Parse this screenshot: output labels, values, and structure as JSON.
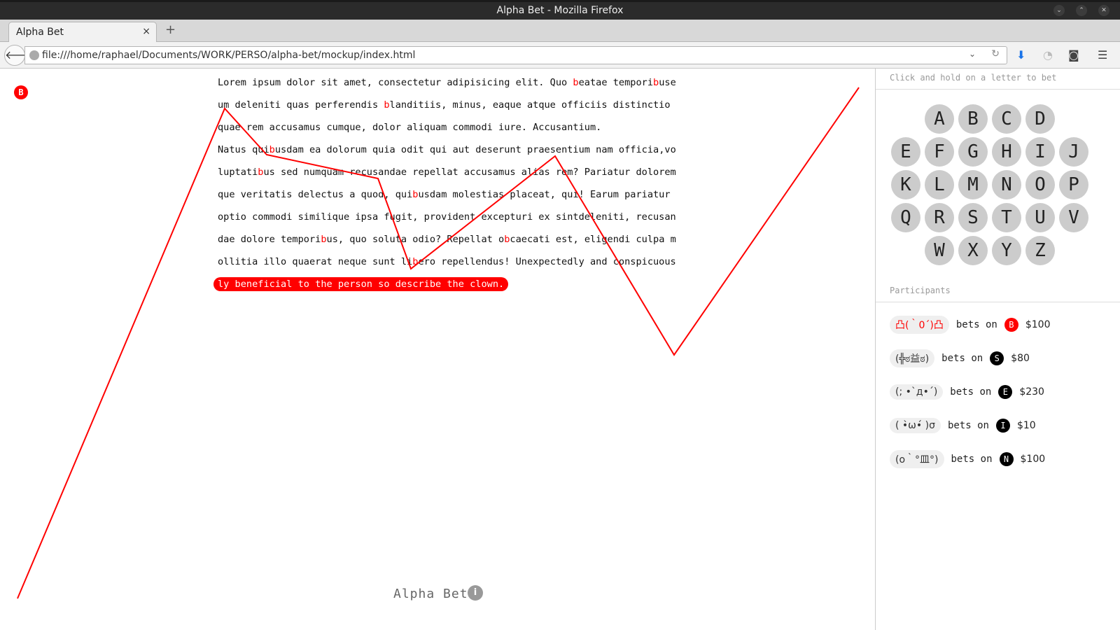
{
  "window": {
    "title": "Alpha Bet - Mozilla Firefox"
  },
  "tab": {
    "label": "Alpha Bet",
    "close": "×",
    "new": "+"
  },
  "nav": {
    "url": "file:///home/raphael/Documents/WORK/PERSO/alpha-bet/mockup/index.html"
  },
  "page": {
    "marker_letter": "B",
    "brand": "Alpha Bet",
    "info": "i",
    "lines": [
      [
        "Lorem ipsum dolor sit amet, consectetur adipisicing elit. Quo ",
        {
          "h": "b"
        },
        "eatae tempori",
        {
          "h": "b"
        },
        "use"
      ],
      [
        "um deleniti quas perferendis ",
        {
          "h": "b"
        },
        "landitiis, minus, eaque atque officiis distinctio"
      ],
      [
        "quae rem accusamus cumque, dolor aliquam commodi iure. Accusantium."
      ],
      [
        "Natus qui",
        {
          "h": "b"
        },
        "usdam ea dolorum quia odit qui aut deserunt praesentium nam officia,vo"
      ],
      [
        "luptati",
        {
          "h": "b"
        },
        "us sed numquam recusandae repellat accusamus alias rem? Pariatur dolorem"
      ],
      [
        "que veritatis delectus a quod, qui",
        {
          "h": "b"
        },
        "usdam molestias placeat, qui! Earum pariatur"
      ],
      [
        "optio commodi similique ipsa fugit, provident excepturi ex sintdeleniti, recusan"
      ],
      [
        "dae dolore tempori",
        {
          "h": "b"
        },
        "us, quo soluta odio? Repellat o",
        {
          "h": "b"
        },
        "caecati est, eligendi culpa m"
      ],
      [
        "ollitia illo quaerat neque sunt li",
        {
          "h": "b"
        },
        "ero repellendus! Unexpectedly and conspicuous"
      ]
    ],
    "last_line": "ly beneficial to the person so describe the clown."
  },
  "sidebar": {
    "hint": "Click and hold on a letter to bet",
    "letters": [
      "A",
      "B",
      "C",
      "D",
      "E",
      "F",
      "G",
      "H",
      "I",
      "J",
      "K",
      "L",
      "M",
      "N",
      "O",
      "P",
      "Q",
      "R",
      "S",
      "T",
      "U",
      "V",
      "W",
      "X",
      "Y",
      "Z"
    ],
    "participants_title": "Participants",
    "bets_word": "bets on",
    "participants": [
      {
        "face": "凸(｀0´)凸",
        "letter": "B",
        "amount": "$100",
        "highlight": true
      },
      {
        "face": "(╬ಠ益ಠ)",
        "letter": "S",
        "amount": "$80",
        "highlight": false
      },
      {
        "face": "(; •`д•´)",
        "letter": "E",
        "amount": "$230",
        "highlight": false
      },
      {
        "face": "( •̀ω•́ )σ",
        "letter": "I",
        "amount": "$10",
        "highlight": false
      },
      {
        "face": "(ο｀°皿°)",
        "letter": "N",
        "amount": "$100",
        "highlight": false
      }
    ]
  },
  "colors": {
    "accent": "#ff0000",
    "key_bg": "#cccccc"
  }
}
